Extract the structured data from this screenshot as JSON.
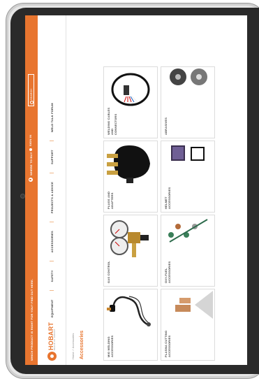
{
  "promo": {
    "message": "WHICH PRODUCT IS RIGHT FOR YOU? FIND OUT HERE.",
    "where_to_buy": "WHERE TO BUY",
    "sign_in": "SIGN IN",
    "search_placeholder": "SEARCH"
  },
  "logo": {
    "brand": "HOBART",
    "sub": "BRAND OF HOBART"
  },
  "nav": {
    "items": [
      "EQUIPMENT",
      "SAFETY",
      "ACCESSORIES",
      "PROJECTS & ADVICE",
      "SUPPORT",
      "WELD TALK FORUM"
    ]
  },
  "breadcrumb": {
    "home": "Home",
    "current": "Accessories"
  },
  "page_title": "Accessories",
  "categories": [
    {
      "label": "MIG WELDING ACCESSORIES",
      "icon": "mig-gun"
    },
    {
      "label": "GAS CONTROL",
      "icon": "gas-regulator"
    },
    {
      "label": "PLUGS AND ADAPTERS",
      "icon": "plug"
    },
    {
      "label": "WELDING CABLES AND CONNECTORS",
      "icon": "welding-cable"
    },
    {
      "label": "PLASMA CUTTING ACCESSORIES",
      "icon": "plasma-consumables"
    },
    {
      "label": "OXY-FUEL ACCESSORIES",
      "icon": "oxy-fuel-kit"
    },
    {
      "label": "HELMET ACCESSORIES",
      "icon": "helmet-lens"
    },
    {
      "label": "ABRASIVES",
      "icon": "abrasive-wheel"
    }
  ],
  "colors": {
    "brand_orange": "#e8752f",
    "frame": "#2a2a2a"
  }
}
